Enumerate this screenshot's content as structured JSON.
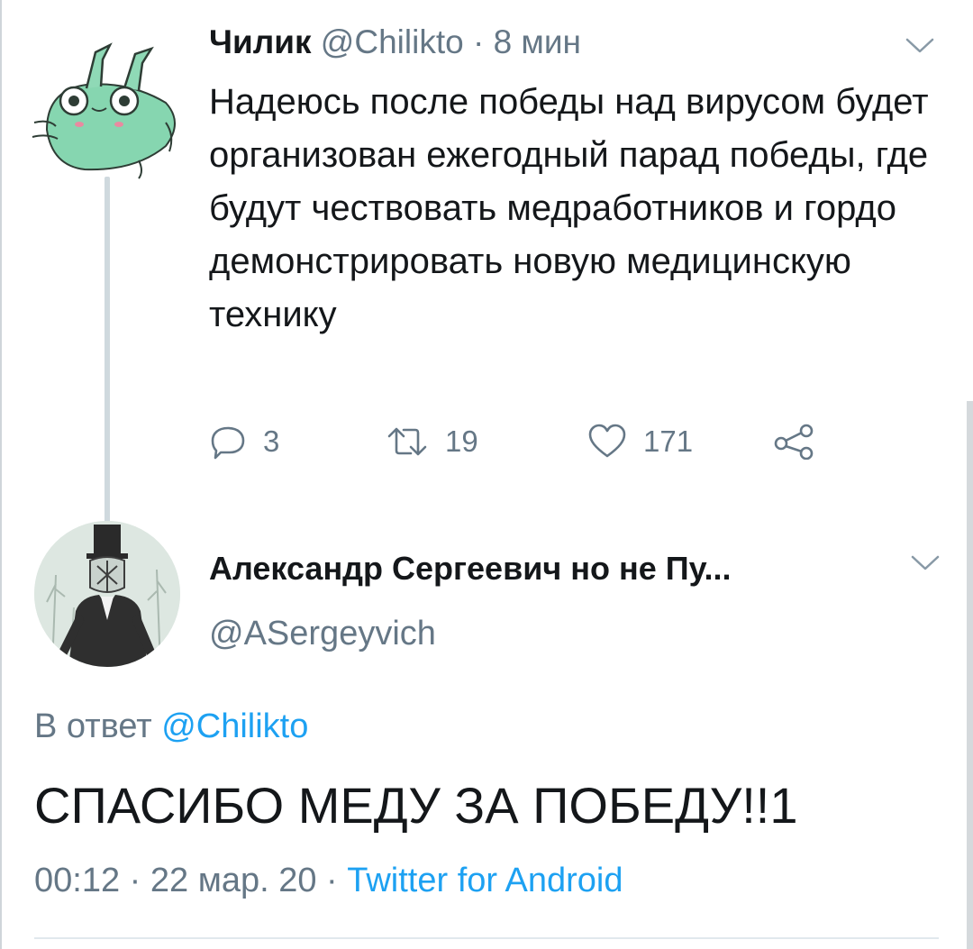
{
  "tweet": {
    "author_name": "Чилик",
    "handle": "@Chilikto",
    "separator": " · ",
    "time": "8 мин",
    "text": "Надеюсь после победы над вирусом будет организован ежегодный парад победы, где будут чествовать медработников и гордо демонстрировать новую медицинскую технику",
    "actions": {
      "replies": "3",
      "retweets": "19",
      "likes": "171"
    }
  },
  "reply": {
    "author_name": "Александр Сергеевич но не Пу...",
    "handle": "@ASergeyvich",
    "reply_prefix": "В ответ ",
    "reply_mention": "@Chilikto",
    "text": "СПАСИБО МЕДУ ЗА ПОБЕДУ!!1",
    "timestamp": "00:12 · 22 мар. 20 · ",
    "client": "Twitter for Android"
  },
  "icons": {
    "reply": "reply-icon",
    "retweet": "retweet-icon",
    "like": "heart-icon",
    "share": "share-icon",
    "menu": "chevron-down-icon"
  },
  "colors": {
    "text": "#14171a",
    "secondary": "#657786",
    "link": "#1da1f2",
    "divider": "#e1e8ed"
  }
}
